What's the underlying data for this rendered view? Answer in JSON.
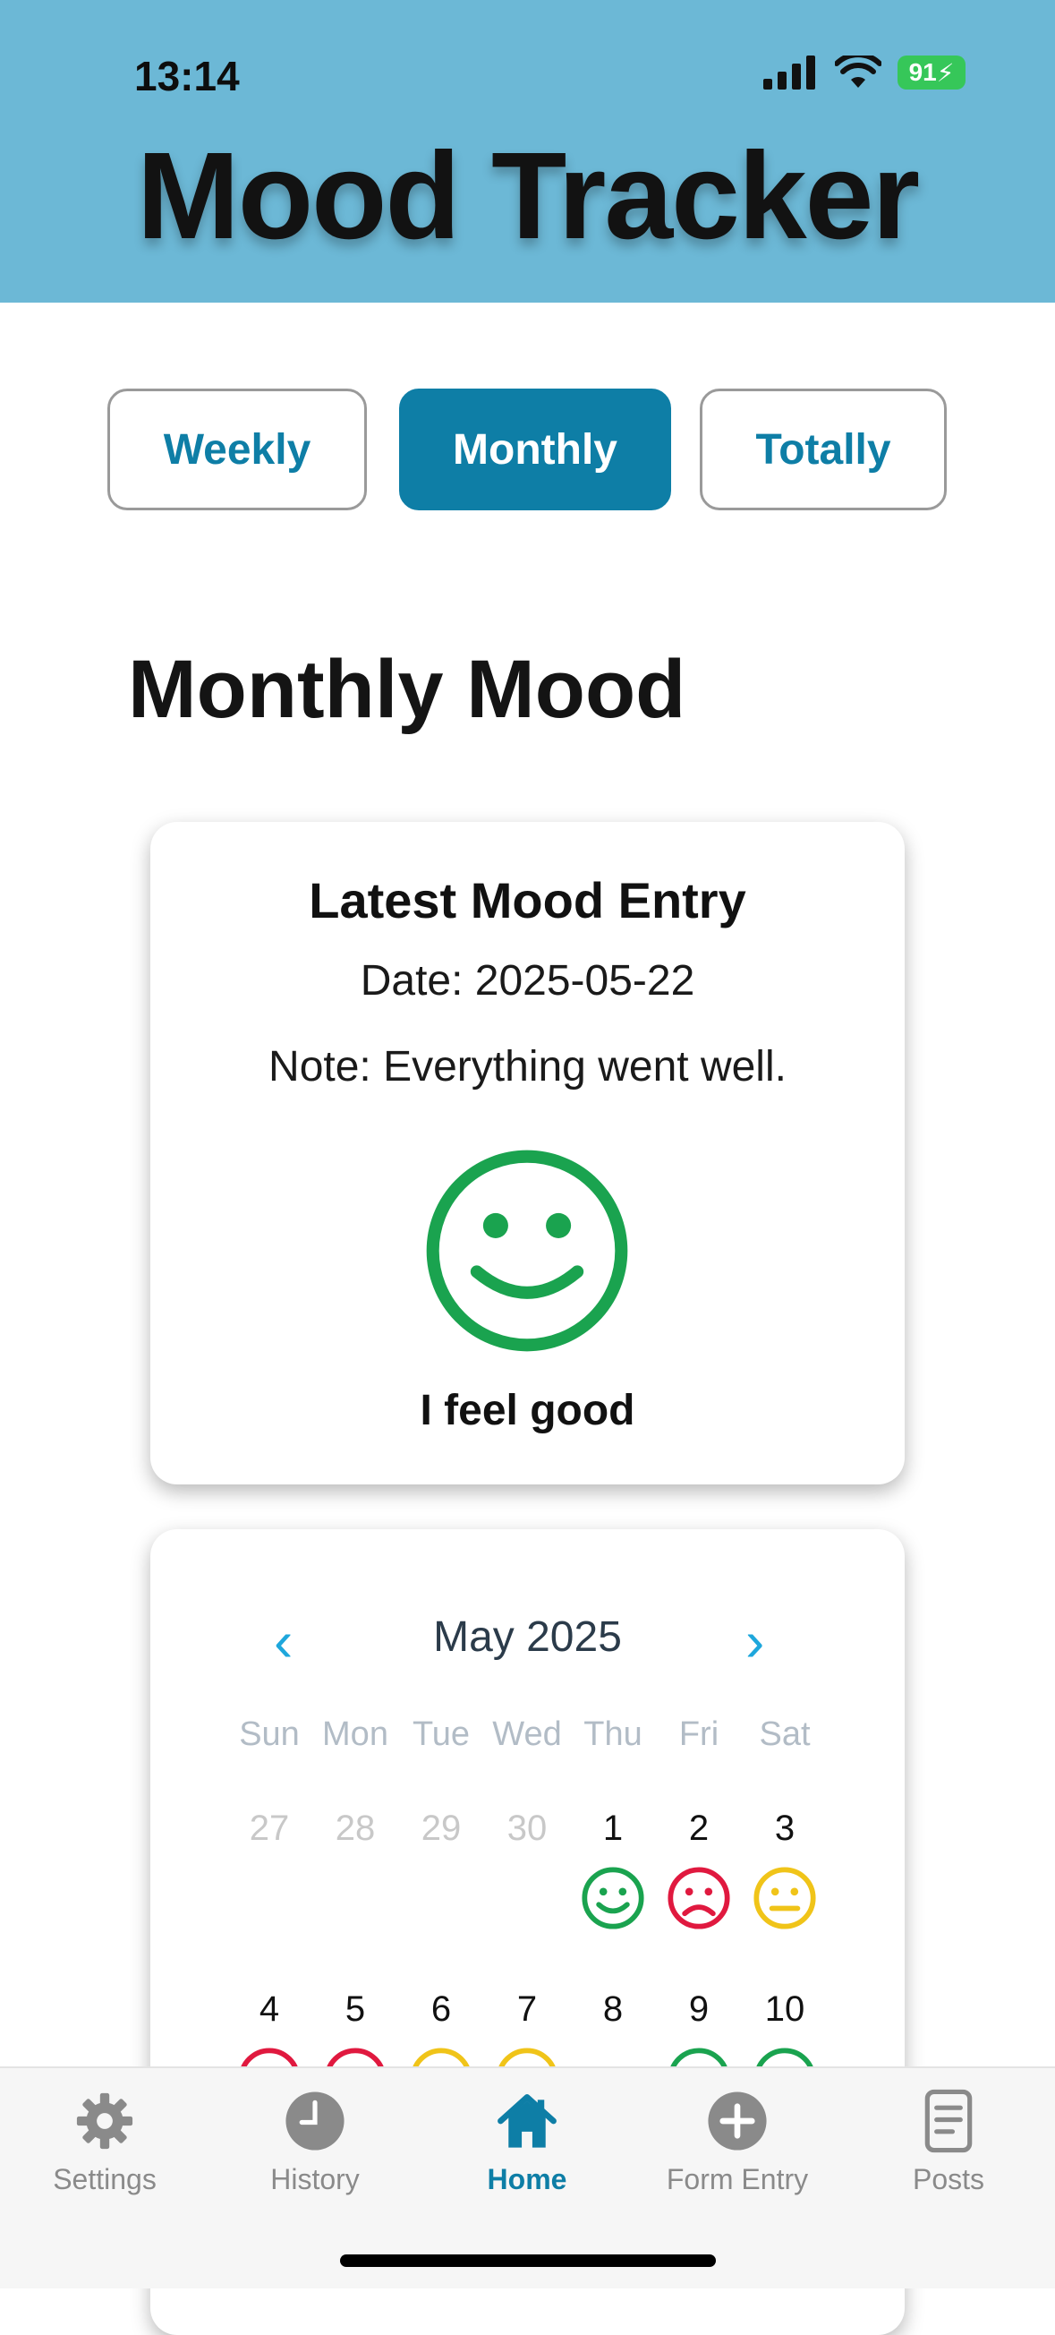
{
  "status_bar": {
    "time": "13:14",
    "battery": "91"
  },
  "app_title": "Mood Tracker",
  "tabs": [
    {
      "label": "Weekly"
    },
    {
      "label": "Monthly"
    },
    {
      "label": "Totally"
    }
  ],
  "section_title": "Monthly Mood",
  "latest_entry": {
    "title": "Latest Mood Entry",
    "date": "Date: 2025-05-22",
    "note": "Note: Everything went well.",
    "mood_icon": "smile-icon",
    "mood_label": "I feel good"
  },
  "calendar": {
    "month_label": "May 2025",
    "weekdays": [
      "Sun",
      "Mon",
      "Tue",
      "Wed",
      "Thu",
      "Fri",
      "Sat"
    ],
    "week1": [
      "27",
      "28",
      "29",
      "30",
      "1",
      "2",
      "3"
    ],
    "week2": [
      "4",
      "5",
      "6",
      "7",
      "8",
      "9",
      "10"
    ]
  },
  "colors": {
    "good": "#1aa34f",
    "bad": "#e0193f",
    "neutral": "#f0c419",
    "accent": "#0e7ea6"
  },
  "nav": [
    {
      "label": "Settings"
    },
    {
      "label": "History"
    },
    {
      "label": "Home"
    },
    {
      "label": "Form Entry"
    },
    {
      "label": "Posts"
    }
  ]
}
